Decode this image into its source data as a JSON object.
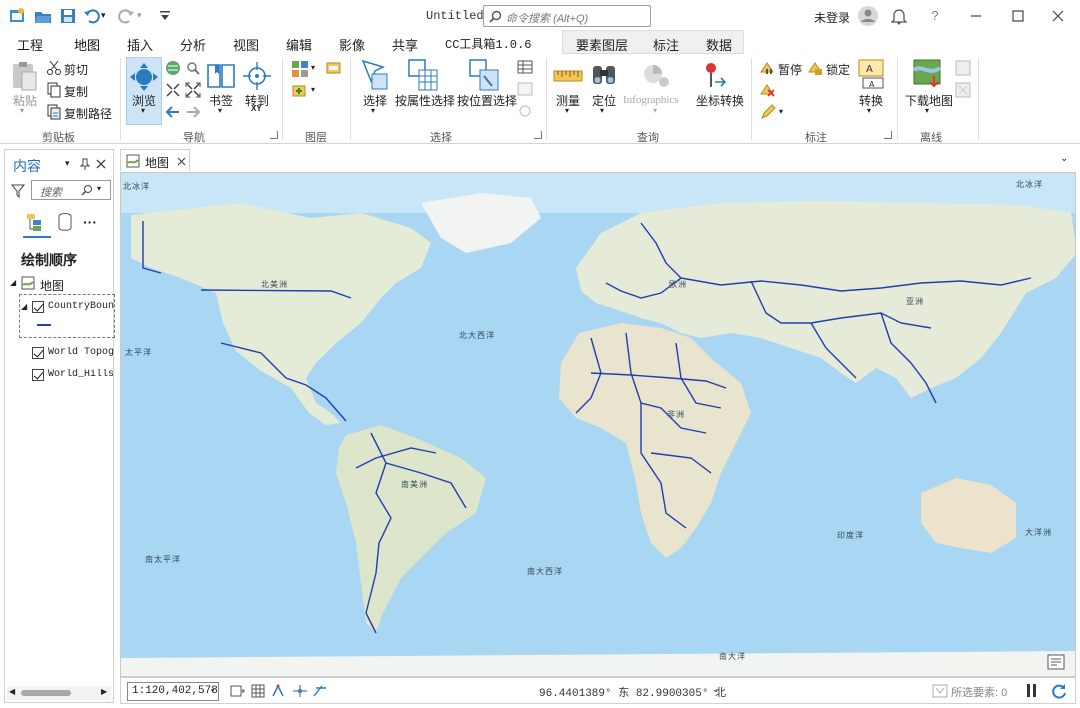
{
  "window": {
    "title": "Untitled",
    "search_placeholder": "命令搜索 (Alt+Q)",
    "user": "未登录",
    "help": "?"
  },
  "tabs": [
    "工程",
    "地图",
    "插入",
    "分析",
    "视图",
    "编辑",
    "影像",
    "共享",
    "CC工具箱1.0.6",
    "要素图层",
    "标注",
    "数据"
  ],
  "ribbon": {
    "clipboard": {
      "paste": "粘贴",
      "cut": "剪切",
      "copy": "复制",
      "copy_path": "复制路径",
      "label": "剪贴板"
    },
    "navigate": {
      "explore": "浏览",
      "bookmarks": "书签",
      "goto": "转到",
      "goto_sub": "XY",
      "label": "导航"
    },
    "layer": {
      "label": "图层"
    },
    "selection": {
      "select": "选择",
      "by_attr": "按属性选择",
      "by_loc": "按位置选择",
      "label": "选择"
    },
    "inquiry": {
      "measure": "测量",
      "locate": "定位",
      "infographics": "Infographics",
      "coord": "坐标转换",
      "label": "查询"
    },
    "labeling": {
      "pause": "暂停",
      "lock": "锁定",
      "convert": "转换",
      "label": "标注"
    },
    "offline": {
      "download": "下载地图",
      "label": "离线"
    }
  },
  "contents": {
    "title": "内容",
    "search_placeholder": "搜索",
    "drawing_order": "绘制顺序",
    "map": "地图",
    "layers": [
      "CountryBoundary",
      "World Topographic Map",
      "World_Hillshade"
    ]
  },
  "map": {
    "tab": "地图",
    "places": [
      "北冰洋",
      "北冰洋",
      "北美洲",
      "北大西洋",
      "太平洋",
      "欧洲",
      "亚洲",
      "非洲",
      "南美洲",
      "南太平洋",
      "南大西洋",
      "印度洋",
      "大洋洲",
      "南大洋"
    ]
  },
  "status": {
    "scale": "1:120,402,578",
    "coords": "96.4401389° 东 82.9900305° 北",
    "selected": "所选要素: 0"
  },
  "colors": {
    "accent": "#2a7bbf",
    "ocean": "#a9d6f2",
    "land": "#e9eee0",
    "boundary": "#1f3fb0"
  }
}
